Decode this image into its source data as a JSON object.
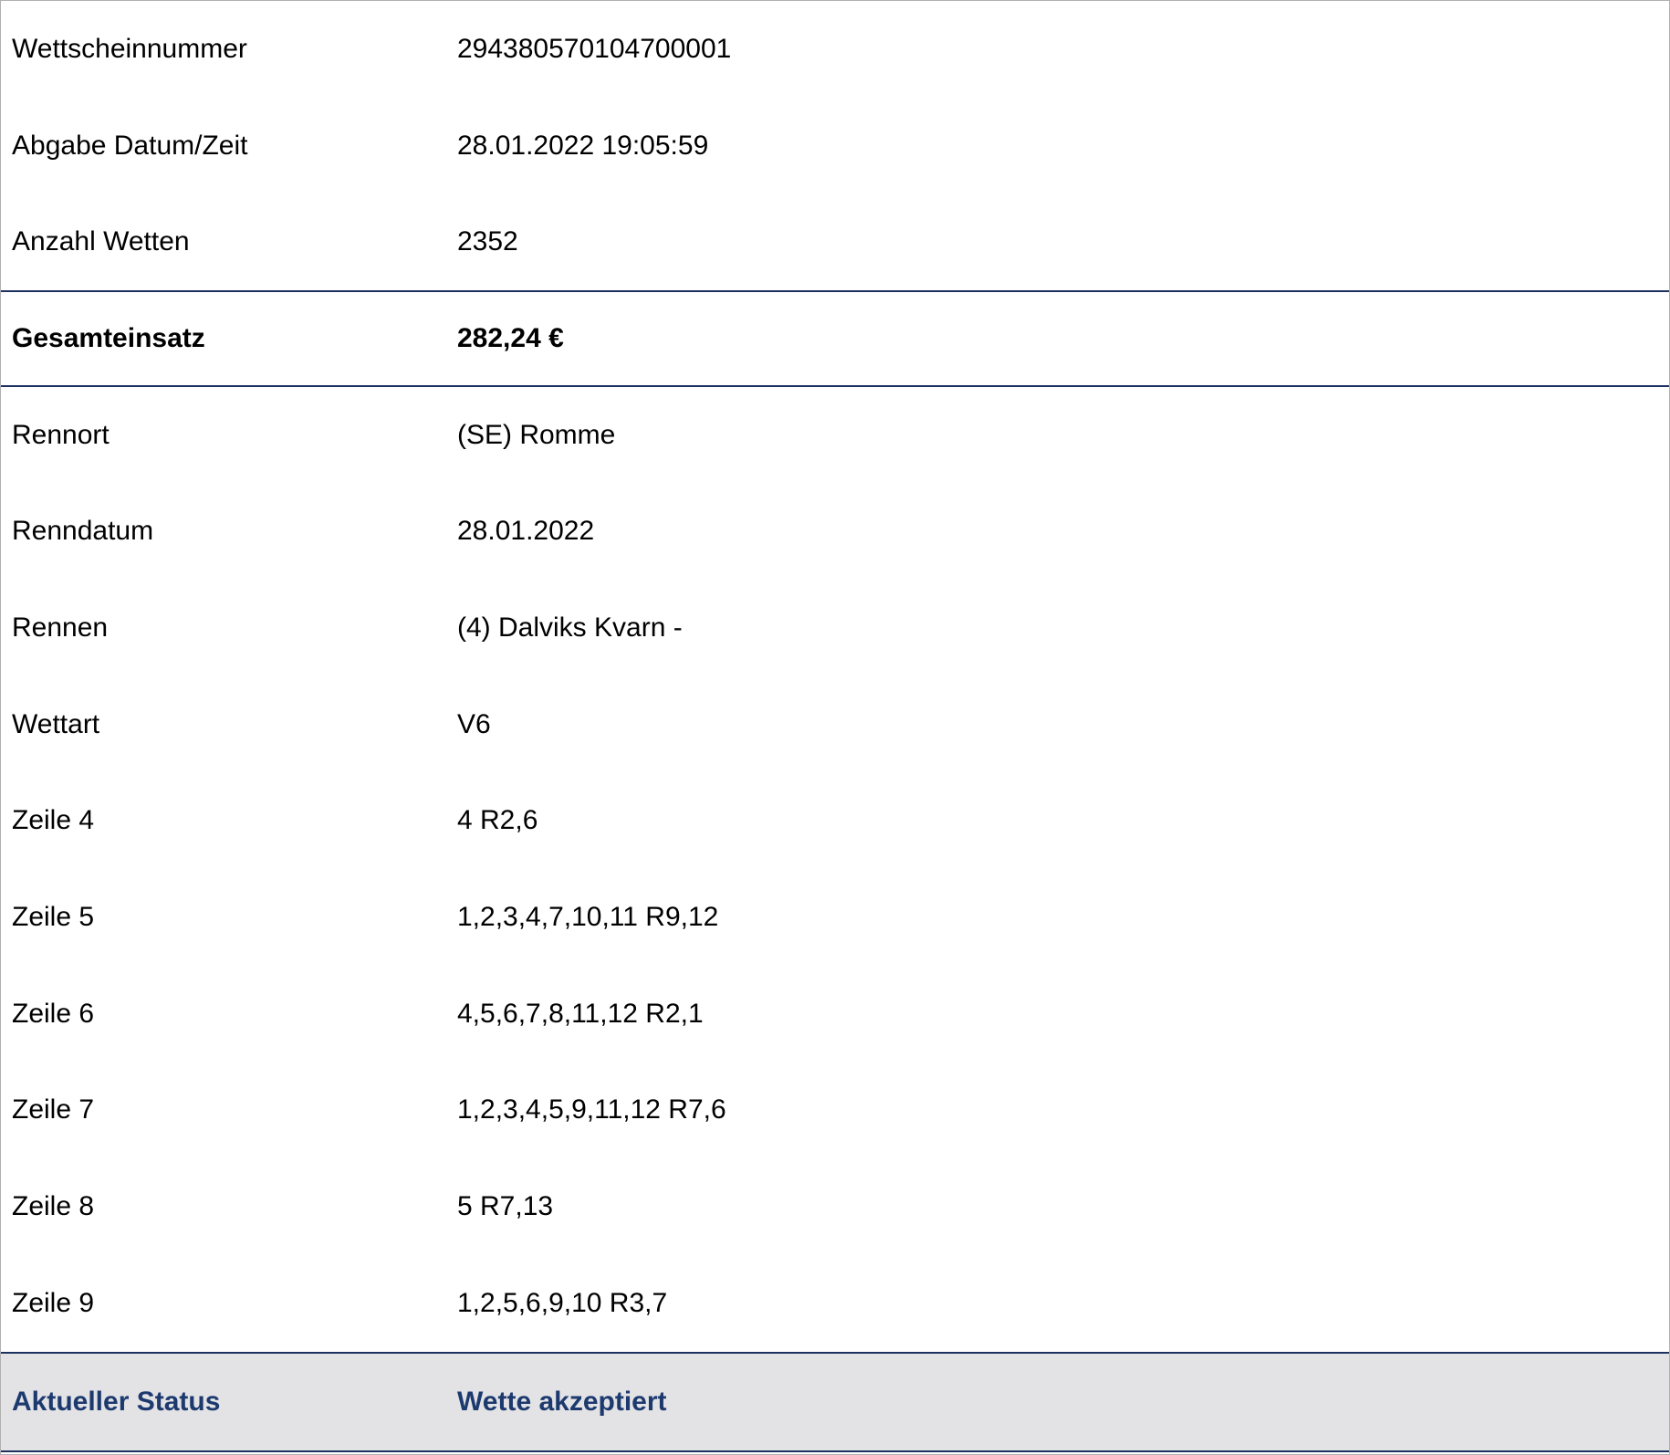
{
  "ticket": {
    "ticket_number": {
      "label": "Wettscheinnummer",
      "value": "294380570104700001"
    },
    "submitted_at": {
      "label": "Abgabe Datum/Zeit",
      "value": "28.01.2022 19:05:59"
    },
    "bet_count": {
      "label": "Anzahl Wetten",
      "value": "2352"
    },
    "total_stake": {
      "label": "Gesamteinsatz",
      "value": "282,24 €"
    },
    "venue": {
      "label": "Rennort",
      "value": "(SE) Romme"
    },
    "race_date": {
      "label": "Renndatum",
      "value": "28.01.2022"
    },
    "race": {
      "label": "Rennen",
      "value": "(4) Dalviks Kvarn -"
    },
    "bet_type": {
      "label": "Wettart",
      "value": "V6"
    },
    "lines": [
      {
        "label": "Zeile 4",
        "value": "4 R2,6"
      },
      {
        "label": "Zeile 5",
        "value": "1,2,3,4,7,10,11 R9,12"
      },
      {
        "label": "Zeile 6",
        "value": "4,5,6,7,8,11,12 R2,1"
      },
      {
        "label": "Zeile 7",
        "value": "1,2,3,4,5,9,11,12 R7,6"
      },
      {
        "label": "Zeile 8",
        "value": "5 R7,13"
      },
      {
        "label": "Zeile 9",
        "value": "1,2,5,6,9,10 R3,7"
      }
    ],
    "status": {
      "label": "Aktueller Status",
      "value": "Wette akzeptiert"
    }
  },
  "colors": {
    "accent": "#1d3a6e",
    "status_background": "#e3e3e6",
    "divider": "#1d3160"
  }
}
